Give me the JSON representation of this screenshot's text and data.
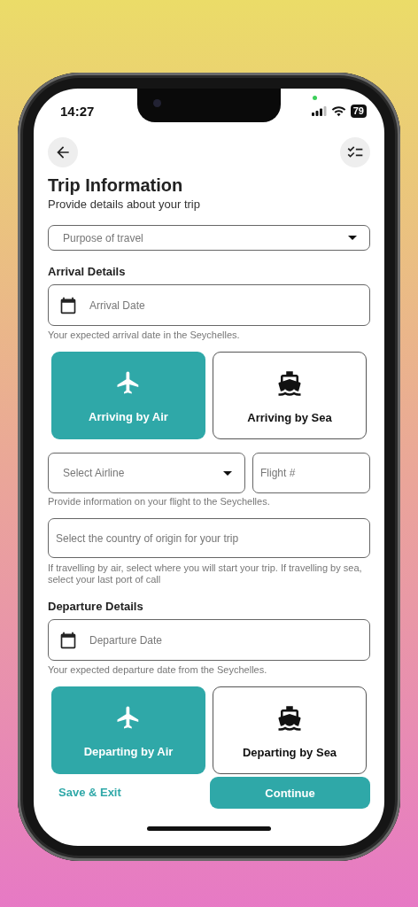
{
  "status_bar": {
    "time": "14:27",
    "battery": "79"
  },
  "header": {
    "title": "Trip Information",
    "subtitle": "Provide details about your trip"
  },
  "items": [
    {
      "kind": "select",
      "placeholder": "Purpose of travel"
    },
    {
      "kind": "heading",
      "text": "Arrival Details"
    },
    {
      "kind": "date",
      "placeholder": "Arrival Date",
      "helper": "Your expected arrival date in the Seychelles."
    },
    {
      "kind": "modes",
      "options": [
        {
          "kind": "air",
          "label": "Arriving by Air",
          "selected": true
        },
        {
          "kind": "sea",
          "label": "Arriving by Sea",
          "selected": false
        }
      ]
    },
    {
      "kind": "flight",
      "airline_placeholder": "Select Airline",
      "flight_placeholder": "Flight #",
      "helper": "Provide information on your flight to the Seychelles."
    },
    {
      "kind": "text",
      "placeholder": "Select the country of origin for your trip",
      "helper": "If travelling by air, select where you will start your trip. If travelling by sea, select your last port of call"
    },
    {
      "kind": "heading",
      "text": "Departure Details"
    },
    {
      "kind": "date",
      "placeholder": "Departure Date",
      "helper": "Your expected departure date from the Seychelles."
    },
    {
      "kind": "modes",
      "options": [
        {
          "kind": "air",
          "label": "Departing by Air",
          "selected": true
        },
        {
          "kind": "sea",
          "label": "Departing by Sea",
          "selected": false
        }
      ]
    }
  ],
  "footer": {
    "secondary": "Save & Exit",
    "primary": "Continue"
  }
}
